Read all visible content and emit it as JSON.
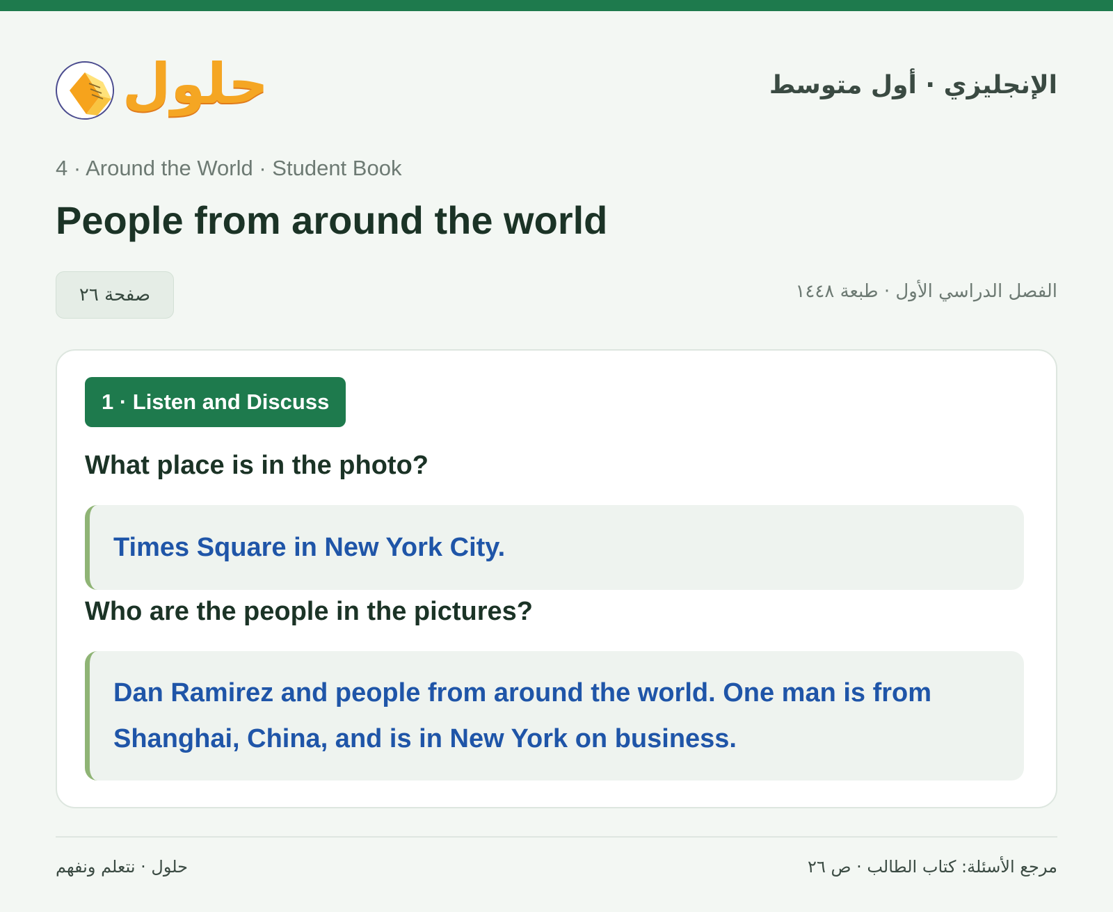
{
  "header": {
    "logo_text": "حلول",
    "subject_title": "الإنجليزي · أول متوسط"
  },
  "breadcrumb": "4 · Around the World · Student Book",
  "page_title": "People from around the world",
  "page_badge": "صفحة ٢٦",
  "edition": "الفصل الدراسي الأول · طبعة ١٤٤٨",
  "card": {
    "section_tag": "1 · Listen and Discuss",
    "items": [
      {
        "question": "What place is in the photo?",
        "answer": "Times Square in New York City."
      },
      {
        "question": "Who are the people in the pictures?",
        "answer": "Dan Ramirez and people from around the world. One man is from Shanghai, China, and is in New York on business."
      }
    ]
  },
  "footer": {
    "left": "حلول · نتعلم ونفهم",
    "right": "مرجع الأسئلة: كتاب الطالب · ص ٢٦"
  },
  "colors": {
    "brand_green": "#1e7a4d",
    "answer_blue": "#1f55a8",
    "logo_orange": "#f5a623"
  }
}
